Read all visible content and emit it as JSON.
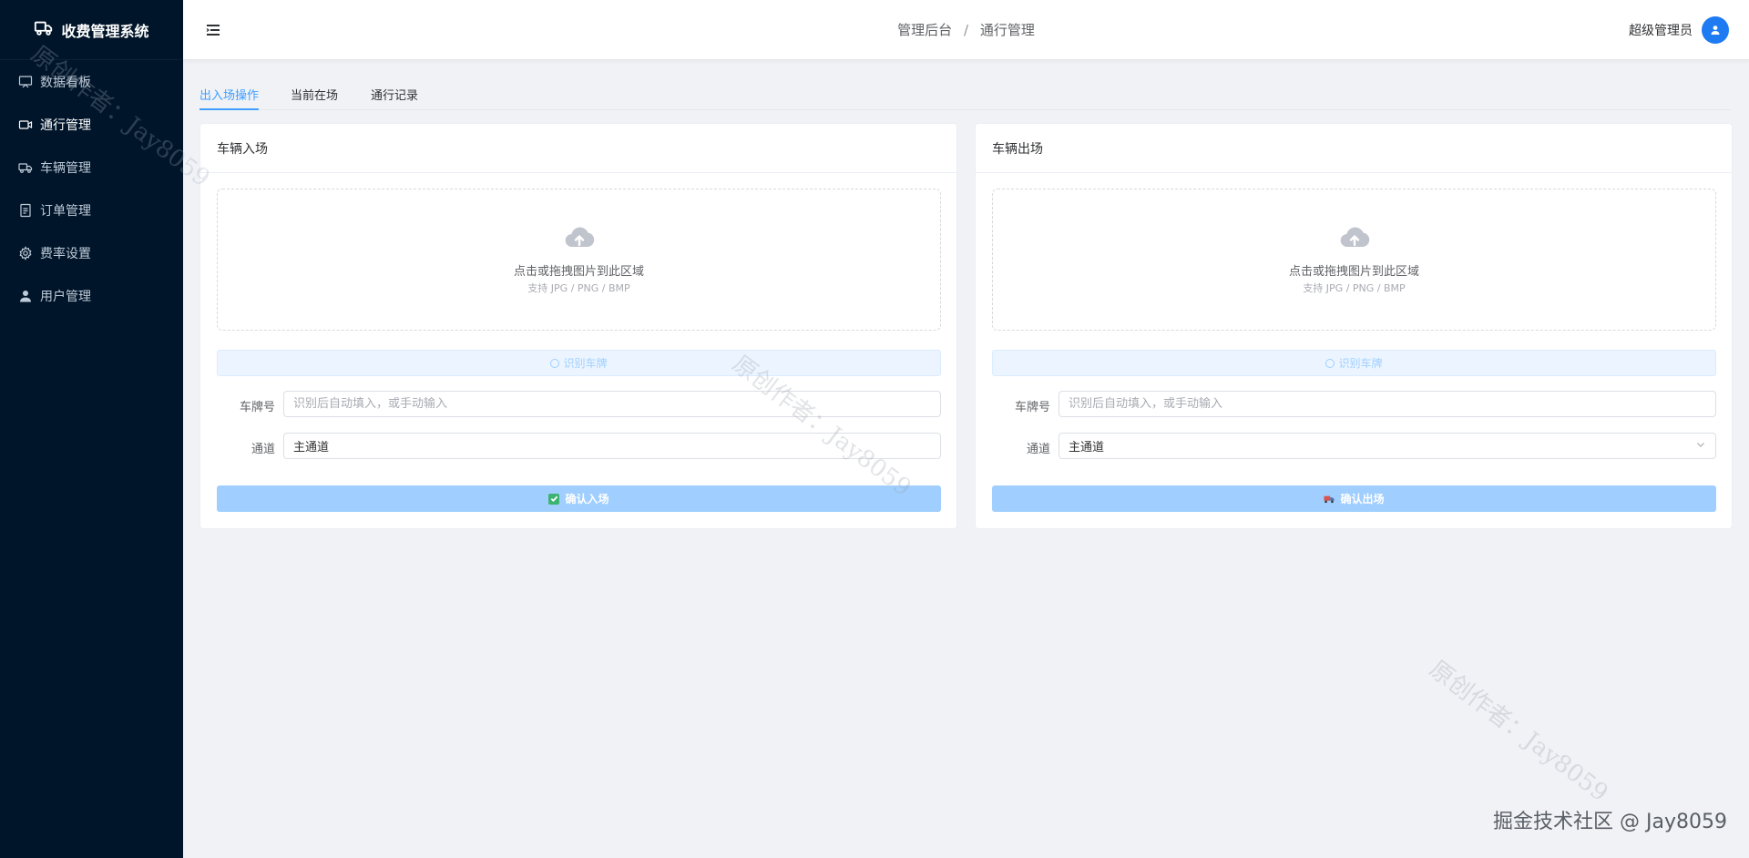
{
  "app": {
    "title": "收费管理系统"
  },
  "sidebar": {
    "items": [
      {
        "label": "数据看板",
        "icon": "dashboard-icon",
        "active": false
      },
      {
        "label": "通行管理",
        "icon": "video-camera-icon",
        "active": true
      },
      {
        "label": "车辆管理",
        "icon": "truck-icon",
        "active": false
      },
      {
        "label": "订单管理",
        "icon": "document-icon",
        "active": false
      },
      {
        "label": "费率设置",
        "icon": "gear-icon",
        "active": false
      },
      {
        "label": "用户管理",
        "icon": "user-icon",
        "active": false
      }
    ]
  },
  "header": {
    "breadcrumb": [
      "管理后台",
      "通行管理"
    ],
    "breadcrumb_separator": "/",
    "user_name": "超级管理员"
  },
  "tabs": [
    {
      "label": "出入场操作",
      "active": true
    },
    {
      "label": "当前在场",
      "active": false
    },
    {
      "label": "通行记录",
      "active": false
    }
  ],
  "entry_card": {
    "title": "车辆入场",
    "upload_text": "点击或拖拽图片到此区域",
    "upload_tip": "支持 JPG / PNG / BMP",
    "recognize_label": "识别车牌",
    "plate_label": "车牌号",
    "plate_placeholder": "识别后自动填入，或手动输入",
    "plate_value": "",
    "channel_label": "通道",
    "channel_value": "主通道",
    "submit_label": "确认入场"
  },
  "exit_card": {
    "title": "车辆出场",
    "upload_text": "点击或拖拽图片到此区域",
    "upload_tip": "支持 JPG / PNG / BMP",
    "recognize_label": "识别车牌",
    "plate_label": "车牌号",
    "plate_placeholder": "识别后自动填入，或手动输入",
    "plate_value": "",
    "channel_label": "通道",
    "channel_value": "主通道",
    "submit_label": "确认出场"
  },
  "watermark": {
    "text": "原创作者：Jay8059"
  },
  "footer": {
    "text": "掘金技术社区 @ Jay8059"
  },
  "colors": {
    "sidebar_bg": "#001529",
    "accent": "#409eff",
    "button_disabled": "#a0cfff",
    "avatar": "#1e7bf2"
  }
}
